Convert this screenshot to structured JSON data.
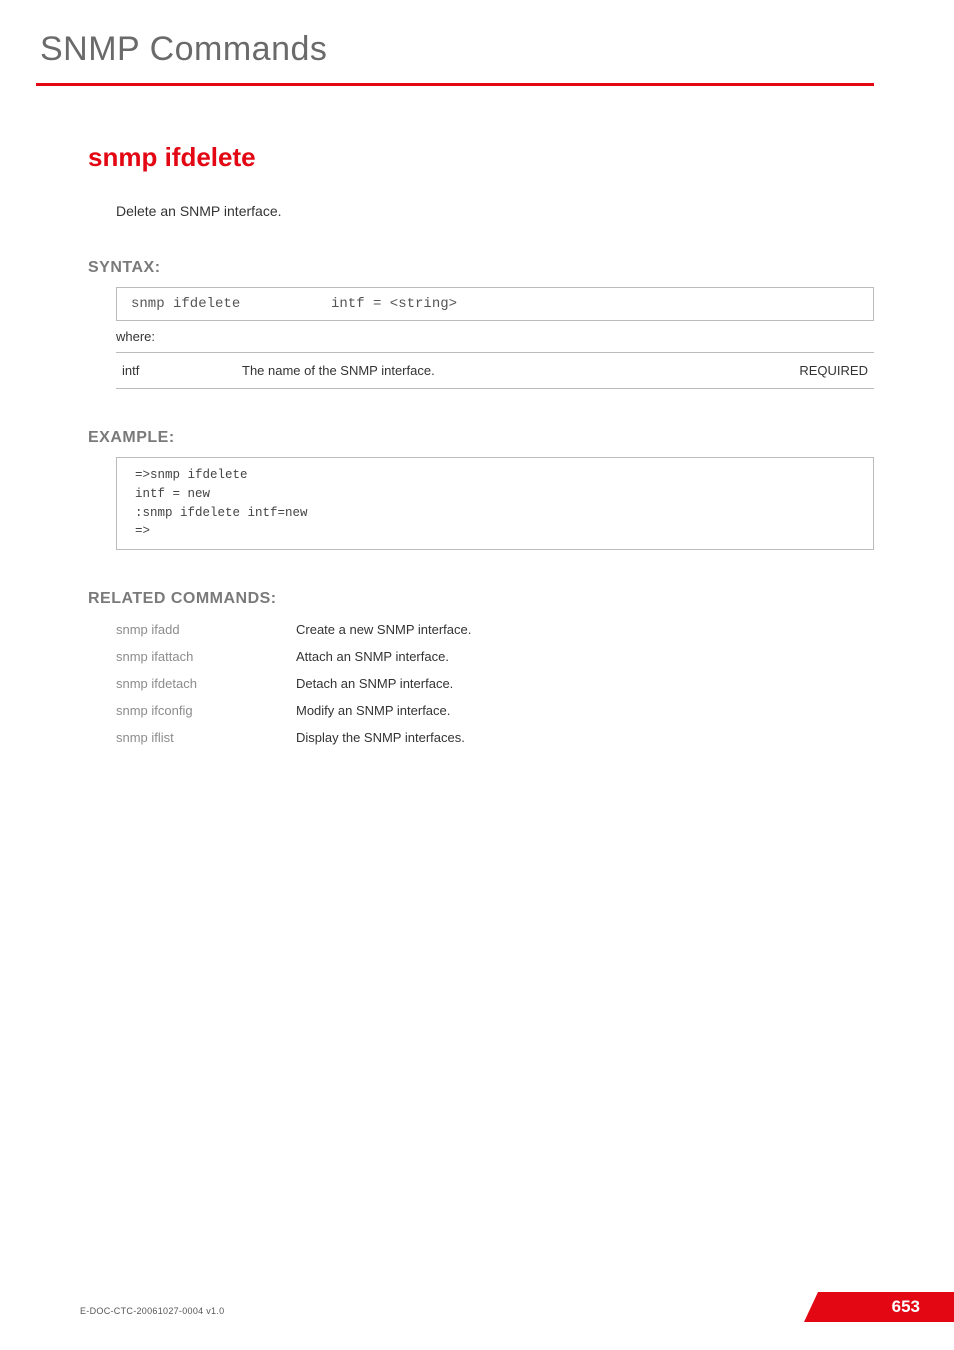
{
  "chapter": {
    "title": "SNMP Commands"
  },
  "command": {
    "title": "snmp ifdelete",
    "description": "Delete an  SNMP interface."
  },
  "syntax": {
    "heading": "SYNTAX:",
    "cmd": "snmp ifdelete",
    "args": "intf = <string>",
    "where_label": "where:",
    "params": [
      {
        "name": "intf",
        "desc": "The name of the  SNMP interface.",
        "req": "REQUIRED"
      }
    ]
  },
  "example": {
    "heading": "EXAMPLE:",
    "body": "=>snmp ifdelete\nintf = new\n:snmp ifdelete intf=new\n=>"
  },
  "related": {
    "heading": "RELATED COMMANDS:",
    "items": [
      {
        "cmd": "snmp ifadd",
        "desc": "Create a new SNMP interface."
      },
      {
        "cmd": "snmp ifattach",
        "desc": "Attach an SNMP interface."
      },
      {
        "cmd": "snmp ifdetach",
        "desc": "Detach an SNMP interface."
      },
      {
        "cmd": "snmp ifconfig",
        "desc": "Modify an SNMP interface."
      },
      {
        "cmd": "snmp iflist",
        "desc": "Display the SNMP interfaces."
      }
    ]
  },
  "footer": {
    "doc_id": "E-DOC-CTC-20061027-0004 v1.0",
    "page": "653"
  }
}
